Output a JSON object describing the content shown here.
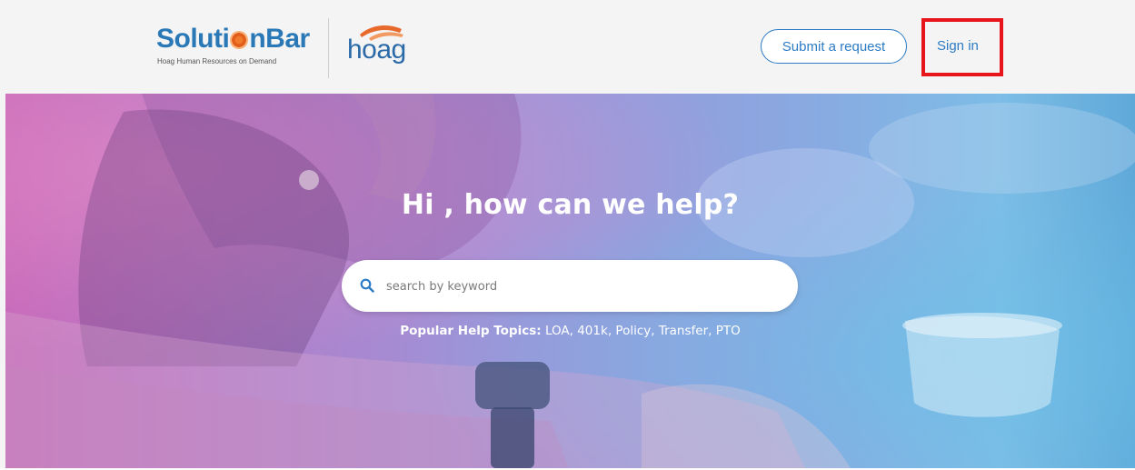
{
  "header": {
    "brand_name_before": "Soluti",
    "brand_name_after": "nBar",
    "brand_tagline": "Hoag Human Resources on Demand",
    "partner_logo_text": "hoag",
    "submit_request_label": "Submit a request",
    "sign_in_label": "Sign in"
  },
  "hero": {
    "title": "Hi , how can we help?",
    "search": {
      "placeholder": "search by keyword",
      "value": ""
    },
    "popular_label": "Popular Help Topics:",
    "topics": [
      "LOA",
      "401k",
      "Policy",
      "Transfer",
      "PTO"
    ]
  },
  "colors": {
    "brand_blue": "#2a78b6",
    "link_blue": "#2c7bc4",
    "highlight_red": "#e8141c"
  }
}
